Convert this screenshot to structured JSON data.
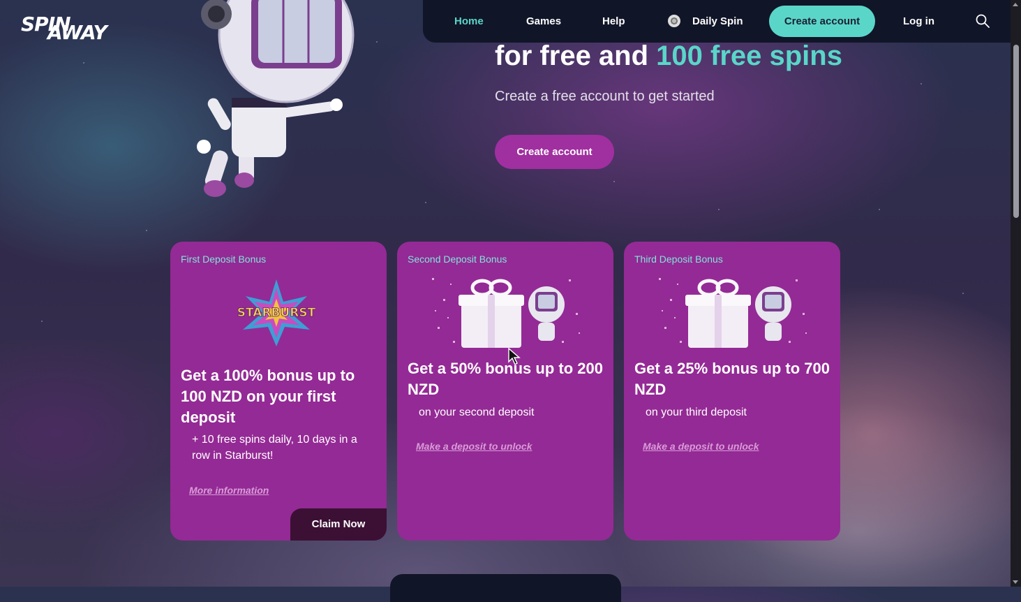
{
  "logo": {
    "line1": "SPIN",
    "line2": "AWAY"
  },
  "nav": {
    "home": "Home",
    "games": "Games",
    "help": "Help",
    "daily_spin": "Daily Spin",
    "create_account": "Create account",
    "log_in": "Log in"
  },
  "hero": {
    "title_plain": "for free and ",
    "title_highlight": "100 free spins",
    "subtitle": "Create a free account to get started",
    "cta": "Create account"
  },
  "mascot": {
    "badge": "SPIN AWAY"
  },
  "cards": [
    {
      "label": "First Deposit Bonus",
      "image_text": "STARBURST",
      "title": "Get a 100% bonus up to 100 NZD on your first deposit",
      "subtitle": "+ 10 free spins daily, 10 days in a row in Starburst!",
      "link": "More information",
      "button": "Claim Now"
    },
    {
      "label": "Second Deposit Bonus",
      "title": "Get a 50% bonus up to 200 NZD",
      "subtitle": "on your second deposit",
      "link": "Make a deposit to unlock"
    },
    {
      "label": "Third Deposit Bonus",
      "title": "Get a 25% bonus up to 700 NZD",
      "subtitle": "on your third deposit",
      "link": "Make a deposit to unlock"
    }
  ],
  "colors": {
    "accent_teal": "#5ad6c9",
    "card_purple": "#942a95",
    "cta_purple": "#a02fa0",
    "nav_dark": "#111528"
  }
}
